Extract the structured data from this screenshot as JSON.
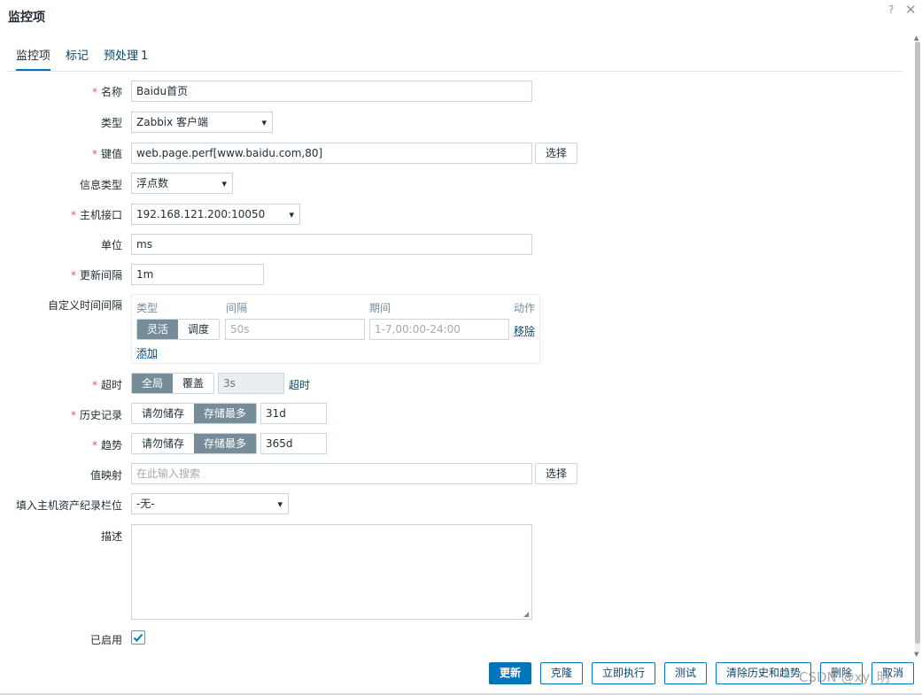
{
  "dialog": {
    "title": "监控项",
    "help": "?",
    "close": "✕"
  },
  "tabs": [
    {
      "label": "监控项"
    },
    {
      "label": "标记"
    },
    {
      "label": "预处理",
      "badge": "1"
    }
  ],
  "form": {
    "name": {
      "label": "名称",
      "value": "Baidu首页"
    },
    "type": {
      "label": "类型",
      "value": "Zabbix 客户端"
    },
    "key": {
      "label": "键值",
      "value": "web.page.perf[www.baidu.com,80]",
      "select": "选择"
    },
    "info_type": {
      "label": "信息类型",
      "value": "浮点数"
    },
    "host_interface": {
      "label": "主机接口",
      "value": "192.168.121.200:10050"
    },
    "units": {
      "label": "单位",
      "value": "ms"
    },
    "update_interval": {
      "label": "更新间隔",
      "value": "1m"
    },
    "custom_intervals": {
      "label": "自定义时间间隔",
      "headers": {
        "type": "类型",
        "interval": "间隔",
        "period": "期间",
        "action": "动作"
      },
      "row": {
        "flex": "灵活",
        "scheduling": "调度",
        "interval_placeholder": "50s",
        "period_placeholder": "1-7,00:00-24:00",
        "remove": "移除"
      },
      "add": "添加"
    },
    "timeout": {
      "label": "超时",
      "global": "全局",
      "override": "覆盖",
      "value": "3s",
      "link": "超时"
    },
    "history": {
      "label": "历史记录",
      "no_store": "请勿储存",
      "store_up_to": "存储最多",
      "value": "31d"
    },
    "trends": {
      "label": "趋势",
      "no_store": "请勿储存",
      "store_up_to": "存储最多",
      "value": "365d"
    },
    "value_mapping": {
      "label": "值映射",
      "placeholder": "在此输入搜索",
      "select": "选择"
    },
    "inventory_field": {
      "label": "填入主机资产纪录栏位",
      "value": "-无-"
    },
    "description": {
      "label": "描述",
      "value": ""
    },
    "enabled": {
      "label": "已启用",
      "checked": true
    }
  },
  "footer": {
    "update": "更新",
    "clone": "克隆",
    "execute_now": "立即执行",
    "test": "测试",
    "clear_history": "清除历史和趋势",
    "delete": "删除",
    "cancel": "取消"
  },
  "watermark": "CSDN @xy_明",
  "colors": {
    "primary": "#0275b8",
    "required": "#e45959",
    "segment_active": "#768d99",
    "link": "#0a466a"
  }
}
